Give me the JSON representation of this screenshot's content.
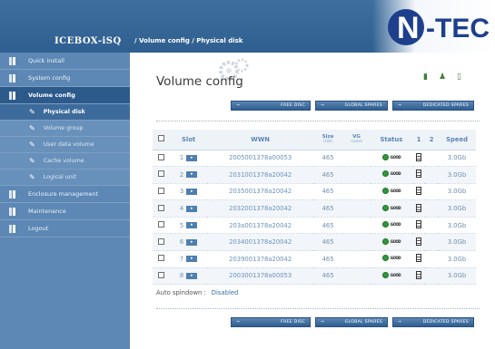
{
  "header": {
    "brand": "ICEBOX-iSQ",
    "breadcrumb": "/ Volume config / Physical disk",
    "logo": "N-TEC"
  },
  "sidebar": {
    "items": [
      {
        "label": "Quick install"
      },
      {
        "label": "System config"
      },
      {
        "label": "Volume config"
      }
    ],
    "subitems": [
      {
        "label": "Physical disk"
      },
      {
        "label": "Volume group"
      },
      {
        "label": "User data volume"
      },
      {
        "label": "Cache volume"
      },
      {
        "label": "Logical unit"
      }
    ],
    "items_after": [
      {
        "label": "Enclosure management"
      },
      {
        "label": "Maintenance"
      },
      {
        "label": "Logout"
      }
    ]
  },
  "main": {
    "title": "Volume config",
    "buttons": {
      "free_disc": "FREE DISC",
      "global_spares": "GLOBAL SPARES",
      "dedicated_spares": "DEDICATED SPARES"
    },
    "columns": {
      "slot": "Slot",
      "wwn": "WWN",
      "size": "Size",
      "size_unit": "(GB)",
      "vg": "VG",
      "vg_sub": "name",
      "status": "Status",
      "c1": "1",
      "c2": "2",
      "speed": "Speed"
    },
    "rows": [
      {
        "slot": "1",
        "wwn": "2005001378a00053",
        "size": "465",
        "speed": "3.0Gb"
      },
      {
        "slot": "2",
        "wwn": "2031001378a20042",
        "size": "465",
        "speed": "3.0Gb"
      },
      {
        "slot": "3",
        "wwn": "2035001378a20042",
        "size": "465",
        "speed": "3.0Gb"
      },
      {
        "slot": "4",
        "wwn": "2032001378a20042",
        "size": "465",
        "speed": "3.0Gb"
      },
      {
        "slot": "5",
        "wwn": "203a001378a20042",
        "size": "465",
        "speed": "3.0Gb"
      },
      {
        "slot": "6",
        "wwn": "2034001378a20042",
        "size": "465",
        "speed": "3.0Gb"
      },
      {
        "slot": "7",
        "wwn": "2039001378a20042",
        "size": "465",
        "speed": "3.0Gb"
      },
      {
        "slot": "8",
        "wwn": "2003001378a00053",
        "size": "465",
        "speed": "3.0Gb"
      }
    ],
    "status_text": "GOOD",
    "auto_spindown_label": "Auto spindown :",
    "auto_spindown_value": "Disabled"
  },
  "colors": {
    "header": "#2f5f90",
    "sidebar": "#5d87b4",
    "accent": "#5b86b4",
    "status_good": "#2e9a3a"
  },
  "icons": [
    "gear-icon",
    "battery-icon",
    "person-icon",
    "lock-icon",
    "arrow-icon",
    "disk-icon",
    "checkbox"
  ]
}
